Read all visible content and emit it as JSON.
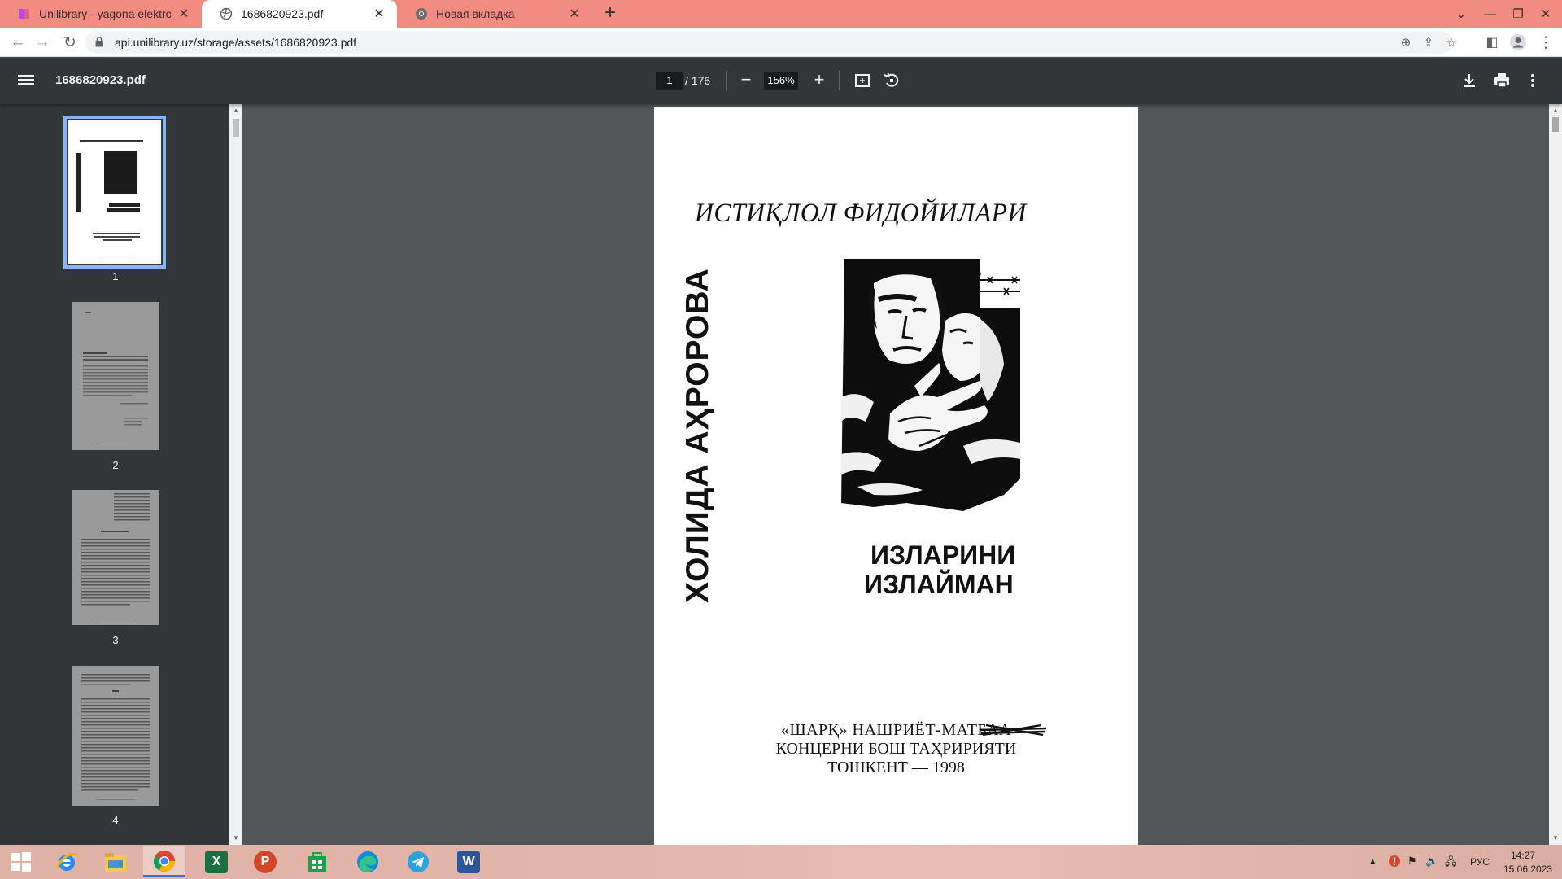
{
  "browser": {
    "tabs": [
      {
        "title": "Unilibrary - yagona elektron kutu",
        "icon": "unilibrary-favicon",
        "active": false
      },
      {
        "title": "1686820923.pdf",
        "icon": "globe-icon",
        "active": true
      },
      {
        "title": "Новая вкладка",
        "icon": "chrome-icon",
        "active": false
      }
    ],
    "new_tab_label": "+",
    "address": "api.unilibrary.uz/storage/assets/1686820923.pdf"
  },
  "viewer": {
    "file_name": "1686820923.pdf",
    "current_page": "1",
    "total_pages": "/ 176",
    "zoom": "156%"
  },
  "sidebar": {
    "thumbnails": [
      {
        "label": "1",
        "selected": true
      },
      {
        "label": "2",
        "selected": false
      },
      {
        "label": "3",
        "selected": false
      },
      {
        "label": "4",
        "selected": false
      }
    ]
  },
  "cover": {
    "series": "ИСТИҚЛОЛ ФИДОЙИЛАРИ",
    "author": "ХОЛИДА АҲРОРОВА",
    "title_line1": "ИЗЛАРИНИ",
    "title_line2": "ИЗЛАЙМАН",
    "publisher_line1": "«ШАРҚ» НАШРИЁТ-МАТБАА",
    "publisher_line2": "КОНЦЕРНИ БОШ ТАҲРИРИЯТИ",
    "publisher_line3": "ТОШКЕНТ — 1998"
  },
  "taskbar": {
    "apps": [
      "windows-start",
      "internet-explorer",
      "file-explorer",
      "chrome",
      "excel",
      "powerpoint",
      "store",
      "edge",
      "telegram",
      "word"
    ],
    "language": "РУС",
    "time": "14:27",
    "date": "15.06.2023"
  },
  "colors": {
    "tabstrip": "#f28b82",
    "viewer_toolbar": "#323639",
    "viewer_bg": "#525659",
    "selection": "#8ab4f8"
  }
}
